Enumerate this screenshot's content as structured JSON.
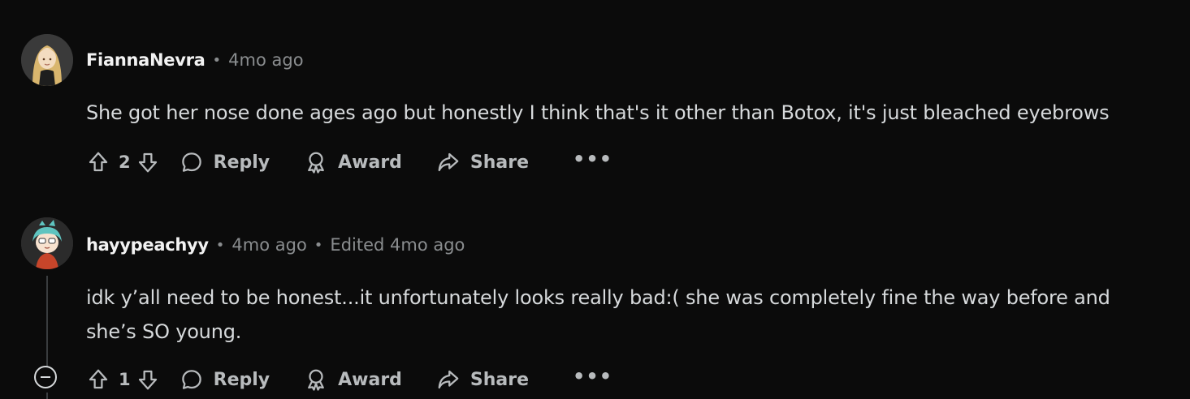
{
  "comments": [
    {
      "username": "FiannaNevra",
      "time": "4mo ago",
      "edited": "",
      "body_lines": [
        "She got her nose done ages ago but honestly I think that's it other than Botox, it's just bleached eyebrows"
      ],
      "votes": "2",
      "avatar_icon": "avatar-blonde-girl",
      "actions": {
        "reply": "Reply",
        "award": "Award",
        "share": "Share",
        "more": "•••"
      }
    },
    {
      "username": "hayypeachyy",
      "time": "4mo ago",
      "edited": "Edited 4mo ago",
      "body_lines": [
        "idk y’all need to be honest...it unfortunately looks really bad:( she was completely fine the way before and",
        "she’s SO young."
      ],
      "votes": "1",
      "avatar_icon": "avatar-teal-hair-character",
      "actions": {
        "reply": "Reply",
        "award": "Award",
        "share": "Share",
        "more": "•••"
      }
    }
  ],
  "separator": "•",
  "colors": {
    "background": "#0b0b0b",
    "text": "#d7dadc",
    "muted": "#8a8d8f",
    "action": "#b8bbbd",
    "username": "#f2f2f2"
  }
}
